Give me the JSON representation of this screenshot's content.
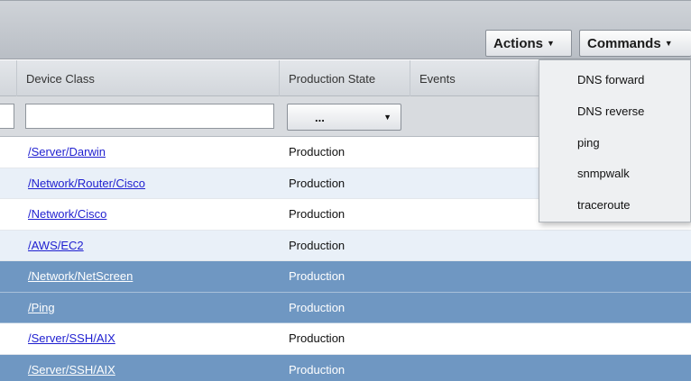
{
  "toolbar": {
    "actions_label": "Actions",
    "commands_label": "Commands"
  },
  "header": {
    "columns": [
      "Device Class",
      "Production State",
      "Events"
    ]
  },
  "filters": {
    "device_class_value": "",
    "production_state_value": "..."
  },
  "rows": [
    {
      "device_class": "/Server/Darwin",
      "production_state": "Production"
    },
    {
      "device_class": "/Network/Router/Cisco",
      "production_state": "Production"
    },
    {
      "device_class": "/Network/Cisco",
      "production_state": "Production"
    },
    {
      "device_class": "/AWS/EC2",
      "production_state": "Production"
    },
    {
      "device_class": "/Network/NetScreen",
      "production_state": "Production"
    },
    {
      "device_class": "/Ping",
      "production_state": "Production"
    },
    {
      "device_class": "/Server/SSH/AIX",
      "production_state": "Production"
    },
    {
      "device_class": "/Server/SSH/AIX",
      "production_state": "Production"
    }
  ],
  "commands_menu": {
    "items": [
      "DNS forward",
      "DNS reverse",
      "ping",
      "snmpwalk",
      "traceroute"
    ]
  },
  "colors": {
    "selected_row": "#6f97c2",
    "alt_row": "#e9f0f8",
    "link": "#1f1fd0"
  }
}
